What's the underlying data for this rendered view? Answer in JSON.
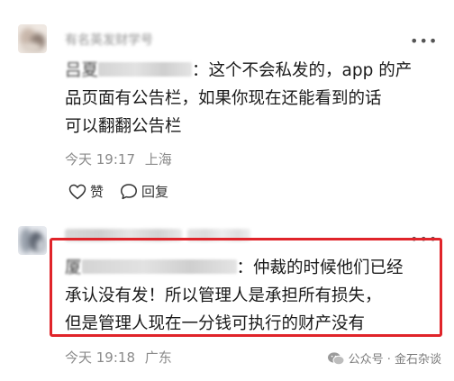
{
  "comments": [
    {
      "username": "有名英发财学号",
      "more_icon": "more-dots-icon",
      "reply_to_name": "吕夏",
      "text_line1": "：这个不会私发的，app 的产",
      "text_line2": "品页面有公告栏，如果你现在还能看到的话",
      "text_line3": "可以翻翻公告栏",
      "time": "今天 19:17",
      "location": "上海",
      "like_label": "赞",
      "reply_label": "回复"
    },
    {
      "username": "",
      "more_icon": "more-dots-icon",
      "reply_to_name": "厦",
      "text_line1": "：仲裁的时候他们已经",
      "text_line2": "承认没有发！所以管理人是承担所有损失，",
      "text_line3": "但是管理人现在一分钱可执行的财产没有",
      "time": "今天 19:18",
      "location": "广东"
    }
  ],
  "watermark": {
    "text": "公众号 · 金石杂谈",
    "icon": "wechat-icon"
  },
  "colors": {
    "highlight": "#e0242a",
    "meta": "#8a8a8a",
    "text": "#1a1a1a"
  }
}
